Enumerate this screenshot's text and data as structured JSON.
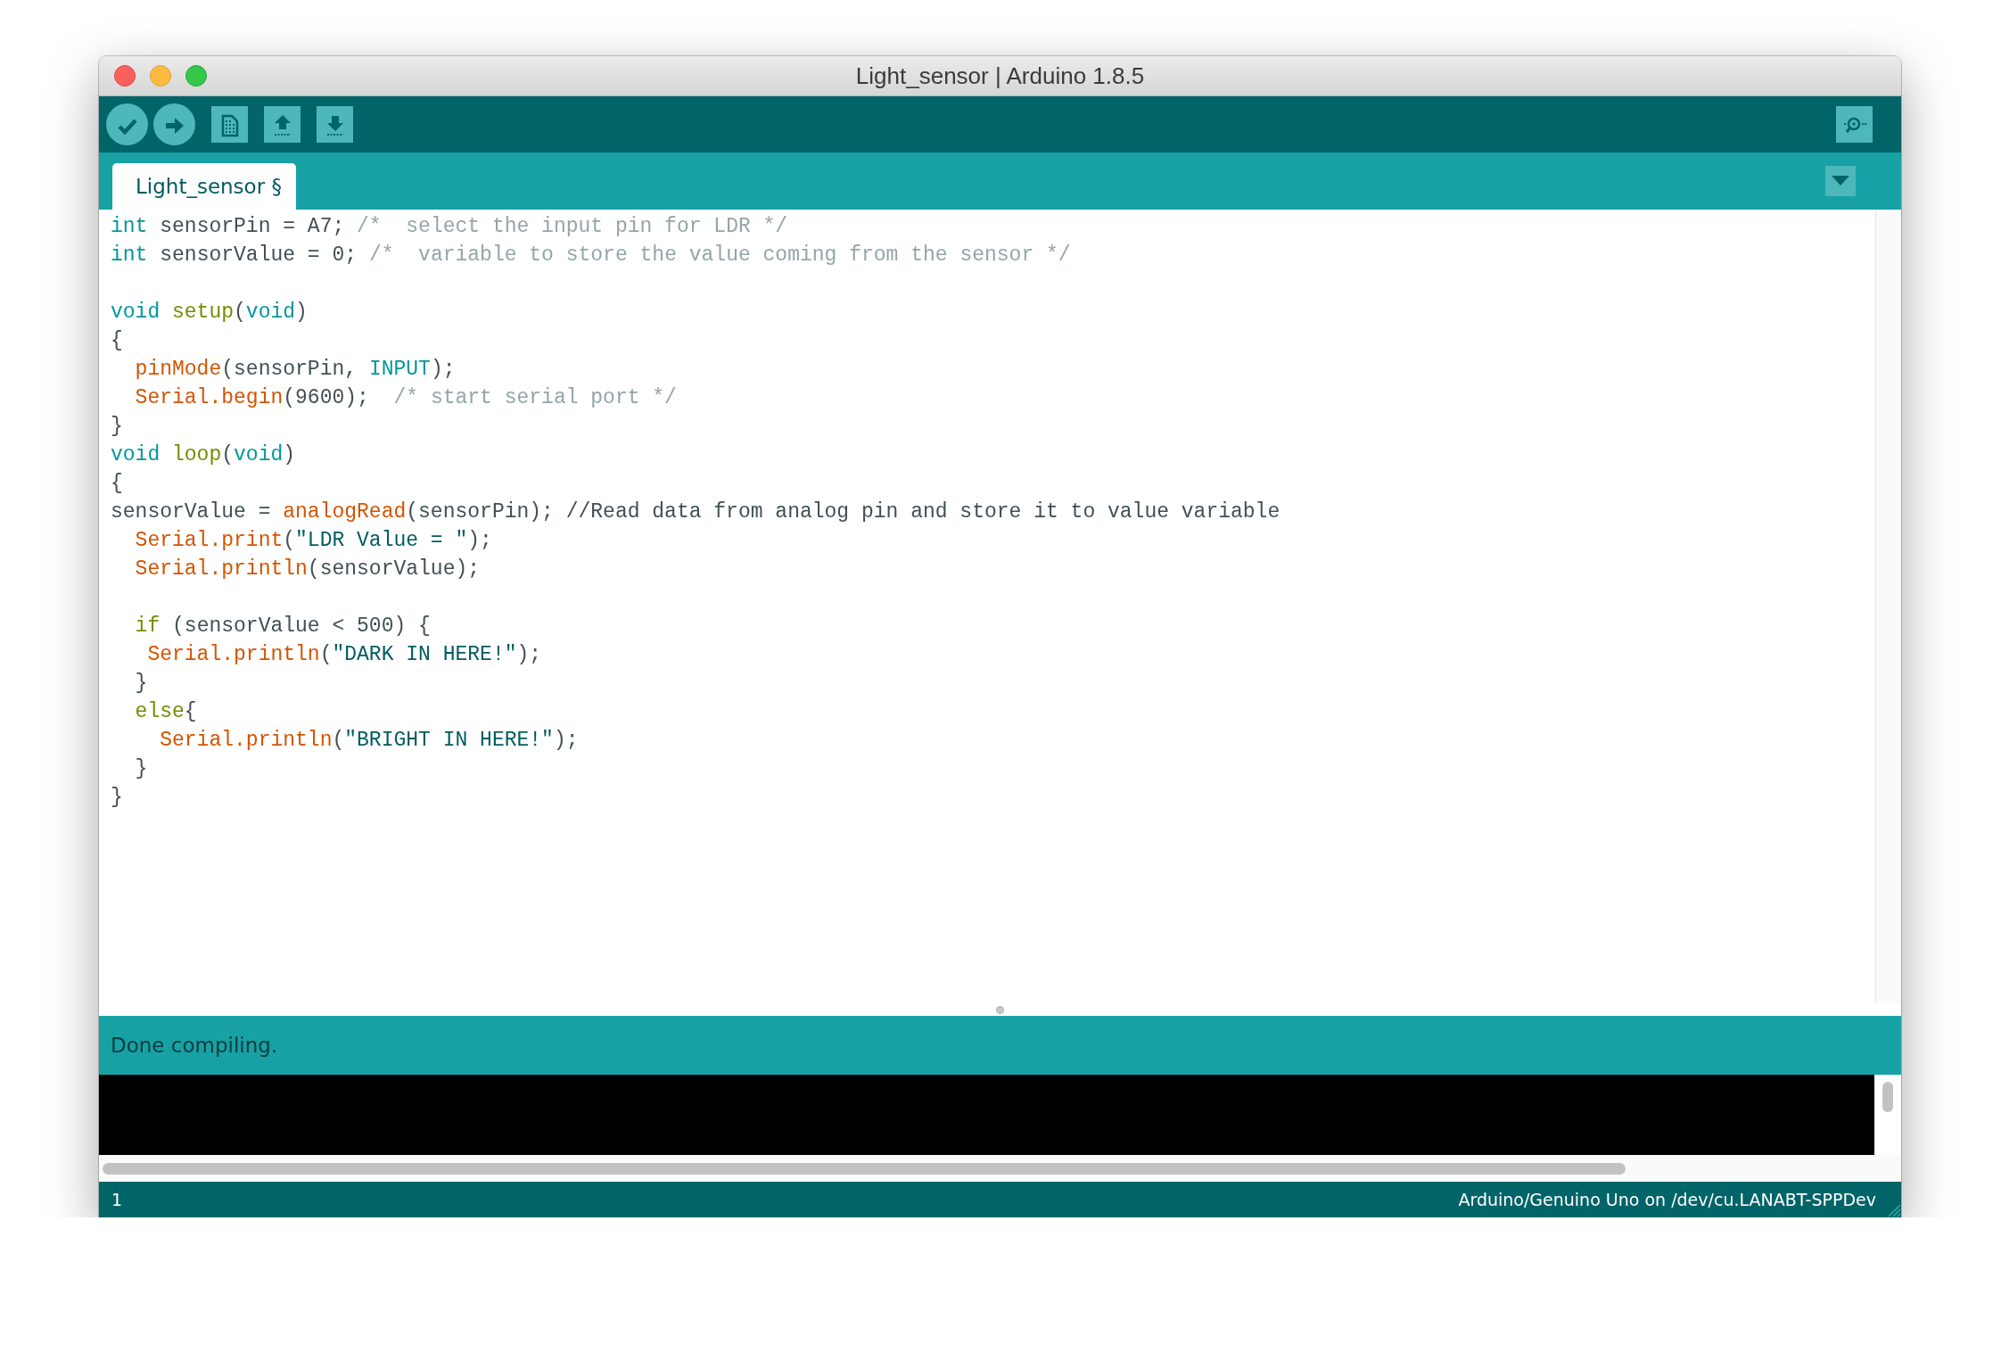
{
  "window": {
    "title": "Light_sensor | Arduino 1.8.5"
  },
  "toolbar": {
    "buttons": [
      {
        "kind": "verify"
      },
      {
        "kind": "upload"
      },
      {
        "kind": "new"
      },
      {
        "kind": "open"
      },
      {
        "kind": "save"
      }
    ],
    "right_button": {
      "kind": "serial"
    }
  },
  "tabs": [
    {
      "label": "Light_sensor §",
      "selected": true
    }
  ],
  "editor": {
    "lines": [
      {
        "kind": "code",
        "tokens": [
          {
            "kind": "type",
            "text": "int"
          },
          {
            "kind": "plain",
            "text": " sensorPin = A7; "
          },
          {
            "kind": "comment",
            "text": "/*  select the input pin for LDR */"
          }
        ]
      },
      {
        "kind": "code",
        "tokens": [
          {
            "kind": "type",
            "text": "int"
          },
          {
            "kind": "plain",
            "text": " sensorValue = 0; "
          },
          {
            "kind": "comment",
            "text": "/*  variable to store the value coming from the sensor */"
          }
        ]
      },
      {
        "kind": "blank"
      },
      {
        "kind": "code",
        "tokens": [
          {
            "kind": "type",
            "text": "void "
          },
          {
            "kind": "ctrl",
            "text": "setup"
          },
          {
            "kind": "plain",
            "text": "("
          },
          {
            "kind": "type",
            "text": "void"
          },
          {
            "kind": "plain",
            "text": ")"
          }
        ]
      },
      {
        "kind": "code",
        "tokens": [
          {
            "kind": "plain",
            "text": "{"
          }
        ]
      },
      {
        "kind": "code",
        "tokens": [
          {
            "kind": "func",
            "text": "  pinMode"
          },
          {
            "kind": "plain",
            "text": "(sensorPin, "
          },
          {
            "kind": "type",
            "text": "INPUT"
          },
          {
            "kind": "plain",
            "text": ");"
          }
        ]
      },
      {
        "kind": "code",
        "tokens": [
          {
            "kind": "func",
            "text": "  Serial.begin"
          },
          {
            "kind": "plain",
            "text": "(9600);  "
          },
          {
            "kind": "comment",
            "text": "/* start serial port */"
          }
        ]
      },
      {
        "kind": "code",
        "tokens": [
          {
            "kind": "plain",
            "text": "}"
          }
        ]
      },
      {
        "kind": "code",
        "tokens": [
          {
            "kind": "type",
            "text": "void "
          },
          {
            "kind": "ctrl",
            "text": "loop"
          },
          {
            "kind": "plain",
            "text": "("
          },
          {
            "kind": "type",
            "text": "void"
          },
          {
            "kind": "plain",
            "text": ")"
          }
        ]
      },
      {
        "kind": "code",
        "tokens": [
          {
            "kind": "plain",
            "text": "{"
          }
        ]
      },
      {
        "kind": "code",
        "tokens": [
          {
            "kind": "plain",
            "text": "sensorValue = "
          },
          {
            "kind": "func",
            "text": "analogRead"
          },
          {
            "kind": "plain",
            "text": "(sensorPin); //Read data from analog pin and store it to value variable"
          }
        ]
      },
      {
        "kind": "code",
        "tokens": [
          {
            "kind": "func",
            "text": "  Serial.print"
          },
          {
            "kind": "plain",
            "text": "("
          },
          {
            "kind": "string",
            "text": "\"LDR Value = \""
          },
          {
            "kind": "plain",
            "text": ");"
          }
        ]
      },
      {
        "kind": "code",
        "tokens": [
          {
            "kind": "func",
            "text": "  Serial.println"
          },
          {
            "kind": "plain",
            "text": "(sensorValue);"
          }
        ]
      },
      {
        "kind": "blank"
      },
      {
        "kind": "code",
        "tokens": [
          {
            "kind": "ctrl",
            "text": "  if"
          },
          {
            "kind": "plain",
            "text": " (sensorValue < 500) {"
          }
        ]
      },
      {
        "kind": "code",
        "tokens": [
          {
            "kind": "func",
            "text": "   Serial.println"
          },
          {
            "kind": "plain",
            "text": "("
          },
          {
            "kind": "string",
            "text": "\"DARK IN HERE!\""
          },
          {
            "kind": "plain",
            "text": ");"
          }
        ]
      },
      {
        "kind": "code",
        "tokens": [
          {
            "kind": "plain",
            "text": "  }"
          }
        ]
      },
      {
        "kind": "code",
        "tokens": [
          {
            "kind": "ctrl",
            "text": "  else"
          },
          {
            "kind": "plain",
            "text": "{"
          }
        ]
      },
      {
        "kind": "code",
        "tokens": [
          {
            "kind": "func",
            "text": "    Serial.println"
          },
          {
            "kind": "plain",
            "text": "("
          },
          {
            "kind": "string",
            "text": "\"BRIGHT IN HERE!\""
          },
          {
            "kind": "plain",
            "text": ");"
          }
        ]
      },
      {
        "kind": "code",
        "tokens": [
          {
            "kind": "plain",
            "text": "  }"
          }
        ]
      },
      {
        "kind": "code",
        "tokens": [
          {
            "kind": "plain",
            "text": "}"
          }
        ]
      }
    ]
  },
  "message": "Done compiling.",
  "status_bar": {
    "line": "1",
    "board": "Arduino/Genuino Uno on /dev/cu.LANABT-SPPDev"
  }
}
